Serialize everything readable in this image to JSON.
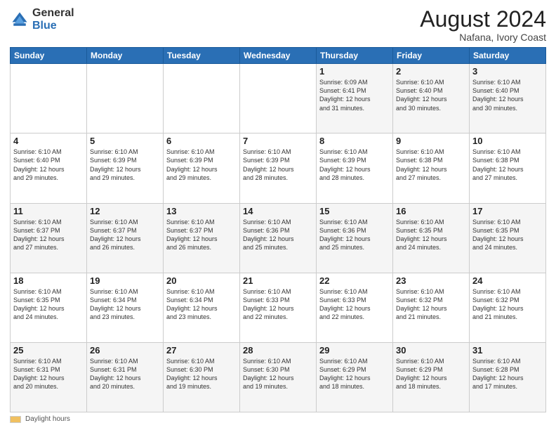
{
  "header": {
    "logo_general": "General",
    "logo_blue": "Blue",
    "main_title": "August 2024",
    "subtitle": "Nafana, Ivory Coast"
  },
  "days_of_week": [
    "Sunday",
    "Monday",
    "Tuesday",
    "Wednesday",
    "Thursday",
    "Friday",
    "Saturday"
  ],
  "weeks": [
    [
      {
        "day": "",
        "info": ""
      },
      {
        "day": "",
        "info": ""
      },
      {
        "day": "",
        "info": ""
      },
      {
        "day": "",
        "info": ""
      },
      {
        "day": "1",
        "info": "Sunrise: 6:09 AM\nSunset: 6:41 PM\nDaylight: 12 hours\nand 31 minutes."
      },
      {
        "day": "2",
        "info": "Sunrise: 6:10 AM\nSunset: 6:40 PM\nDaylight: 12 hours\nand 30 minutes."
      },
      {
        "day": "3",
        "info": "Sunrise: 6:10 AM\nSunset: 6:40 PM\nDaylight: 12 hours\nand 30 minutes."
      }
    ],
    [
      {
        "day": "4",
        "info": "Sunrise: 6:10 AM\nSunset: 6:40 PM\nDaylight: 12 hours\nand 29 minutes."
      },
      {
        "day": "5",
        "info": "Sunrise: 6:10 AM\nSunset: 6:39 PM\nDaylight: 12 hours\nand 29 minutes."
      },
      {
        "day": "6",
        "info": "Sunrise: 6:10 AM\nSunset: 6:39 PM\nDaylight: 12 hours\nand 29 minutes."
      },
      {
        "day": "7",
        "info": "Sunrise: 6:10 AM\nSunset: 6:39 PM\nDaylight: 12 hours\nand 28 minutes."
      },
      {
        "day": "8",
        "info": "Sunrise: 6:10 AM\nSunset: 6:39 PM\nDaylight: 12 hours\nand 28 minutes."
      },
      {
        "day": "9",
        "info": "Sunrise: 6:10 AM\nSunset: 6:38 PM\nDaylight: 12 hours\nand 27 minutes."
      },
      {
        "day": "10",
        "info": "Sunrise: 6:10 AM\nSunset: 6:38 PM\nDaylight: 12 hours\nand 27 minutes."
      }
    ],
    [
      {
        "day": "11",
        "info": "Sunrise: 6:10 AM\nSunset: 6:37 PM\nDaylight: 12 hours\nand 27 minutes."
      },
      {
        "day": "12",
        "info": "Sunrise: 6:10 AM\nSunset: 6:37 PM\nDaylight: 12 hours\nand 26 minutes."
      },
      {
        "day": "13",
        "info": "Sunrise: 6:10 AM\nSunset: 6:37 PM\nDaylight: 12 hours\nand 26 minutes."
      },
      {
        "day": "14",
        "info": "Sunrise: 6:10 AM\nSunset: 6:36 PM\nDaylight: 12 hours\nand 25 minutes."
      },
      {
        "day": "15",
        "info": "Sunrise: 6:10 AM\nSunset: 6:36 PM\nDaylight: 12 hours\nand 25 minutes."
      },
      {
        "day": "16",
        "info": "Sunrise: 6:10 AM\nSunset: 6:35 PM\nDaylight: 12 hours\nand 24 minutes."
      },
      {
        "day": "17",
        "info": "Sunrise: 6:10 AM\nSunset: 6:35 PM\nDaylight: 12 hours\nand 24 minutes."
      }
    ],
    [
      {
        "day": "18",
        "info": "Sunrise: 6:10 AM\nSunset: 6:35 PM\nDaylight: 12 hours\nand 24 minutes."
      },
      {
        "day": "19",
        "info": "Sunrise: 6:10 AM\nSunset: 6:34 PM\nDaylight: 12 hours\nand 23 minutes."
      },
      {
        "day": "20",
        "info": "Sunrise: 6:10 AM\nSunset: 6:34 PM\nDaylight: 12 hours\nand 23 minutes."
      },
      {
        "day": "21",
        "info": "Sunrise: 6:10 AM\nSunset: 6:33 PM\nDaylight: 12 hours\nand 22 minutes."
      },
      {
        "day": "22",
        "info": "Sunrise: 6:10 AM\nSunset: 6:33 PM\nDaylight: 12 hours\nand 22 minutes."
      },
      {
        "day": "23",
        "info": "Sunrise: 6:10 AM\nSunset: 6:32 PM\nDaylight: 12 hours\nand 21 minutes."
      },
      {
        "day": "24",
        "info": "Sunrise: 6:10 AM\nSunset: 6:32 PM\nDaylight: 12 hours\nand 21 minutes."
      }
    ],
    [
      {
        "day": "25",
        "info": "Sunrise: 6:10 AM\nSunset: 6:31 PM\nDaylight: 12 hours\nand 20 minutes."
      },
      {
        "day": "26",
        "info": "Sunrise: 6:10 AM\nSunset: 6:31 PM\nDaylight: 12 hours\nand 20 minutes."
      },
      {
        "day": "27",
        "info": "Sunrise: 6:10 AM\nSunset: 6:30 PM\nDaylight: 12 hours\nand 19 minutes."
      },
      {
        "day": "28",
        "info": "Sunrise: 6:10 AM\nSunset: 6:30 PM\nDaylight: 12 hours\nand 19 minutes."
      },
      {
        "day": "29",
        "info": "Sunrise: 6:10 AM\nSunset: 6:29 PM\nDaylight: 12 hours\nand 18 minutes."
      },
      {
        "day": "30",
        "info": "Sunrise: 6:10 AM\nSunset: 6:29 PM\nDaylight: 12 hours\nand 18 minutes."
      },
      {
        "day": "31",
        "info": "Sunrise: 6:10 AM\nSunset: 6:28 PM\nDaylight: 12 hours\nand 17 minutes."
      }
    ]
  ],
  "legend": {
    "daylight_label": "Daylight hours"
  }
}
